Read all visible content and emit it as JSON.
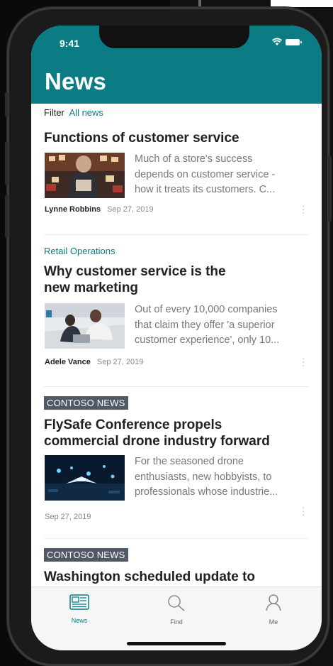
{
  "status_bar": {
    "time": "9:41"
  },
  "header": {
    "title": "News"
  },
  "filter": {
    "label": "Filter",
    "value": "All news"
  },
  "articles": [
    {
      "title": "Functions of customer service",
      "snippet_lines": [
        "Much of a store's success",
        "depends on customer service -",
        "how it treats its customers. C..."
      ],
      "author": "Lynne Robbins",
      "date": "Sep 27, 2019"
    },
    {
      "category": "Retail Operations",
      "title_lines": [
        "Why customer service is the",
        "new marketing"
      ],
      "snippet_lines": [
        "Out of every 10,000 companies",
        "that claim they offer 'a superior",
        "customer experience', only 10..."
      ],
      "author": "Adele Vance",
      "date": "Sep 27, 2019"
    },
    {
      "badge": "CONTOSO NEWS",
      "title_lines": [
        "FlySafe Conference propels",
        "commercial drone industry forward"
      ],
      "snippet_lines": [
        "For the seasoned drone",
        "enthusiasts, new hobbyists, to",
        "professionals whose industrie..."
      ],
      "date": "Sep 27, 2019"
    },
    {
      "badge": "CONTOSO NEWS",
      "title": "Washington scheduled update to"
    }
  ],
  "tabs": [
    {
      "label": "News",
      "icon": "news-icon",
      "active": true
    },
    {
      "label": "Find",
      "icon": "search-icon"
    },
    {
      "label": "Me",
      "icon": "person-icon"
    }
  ],
  "colors": {
    "accent": "#0c7c84",
    "badge": "#505a66"
  }
}
